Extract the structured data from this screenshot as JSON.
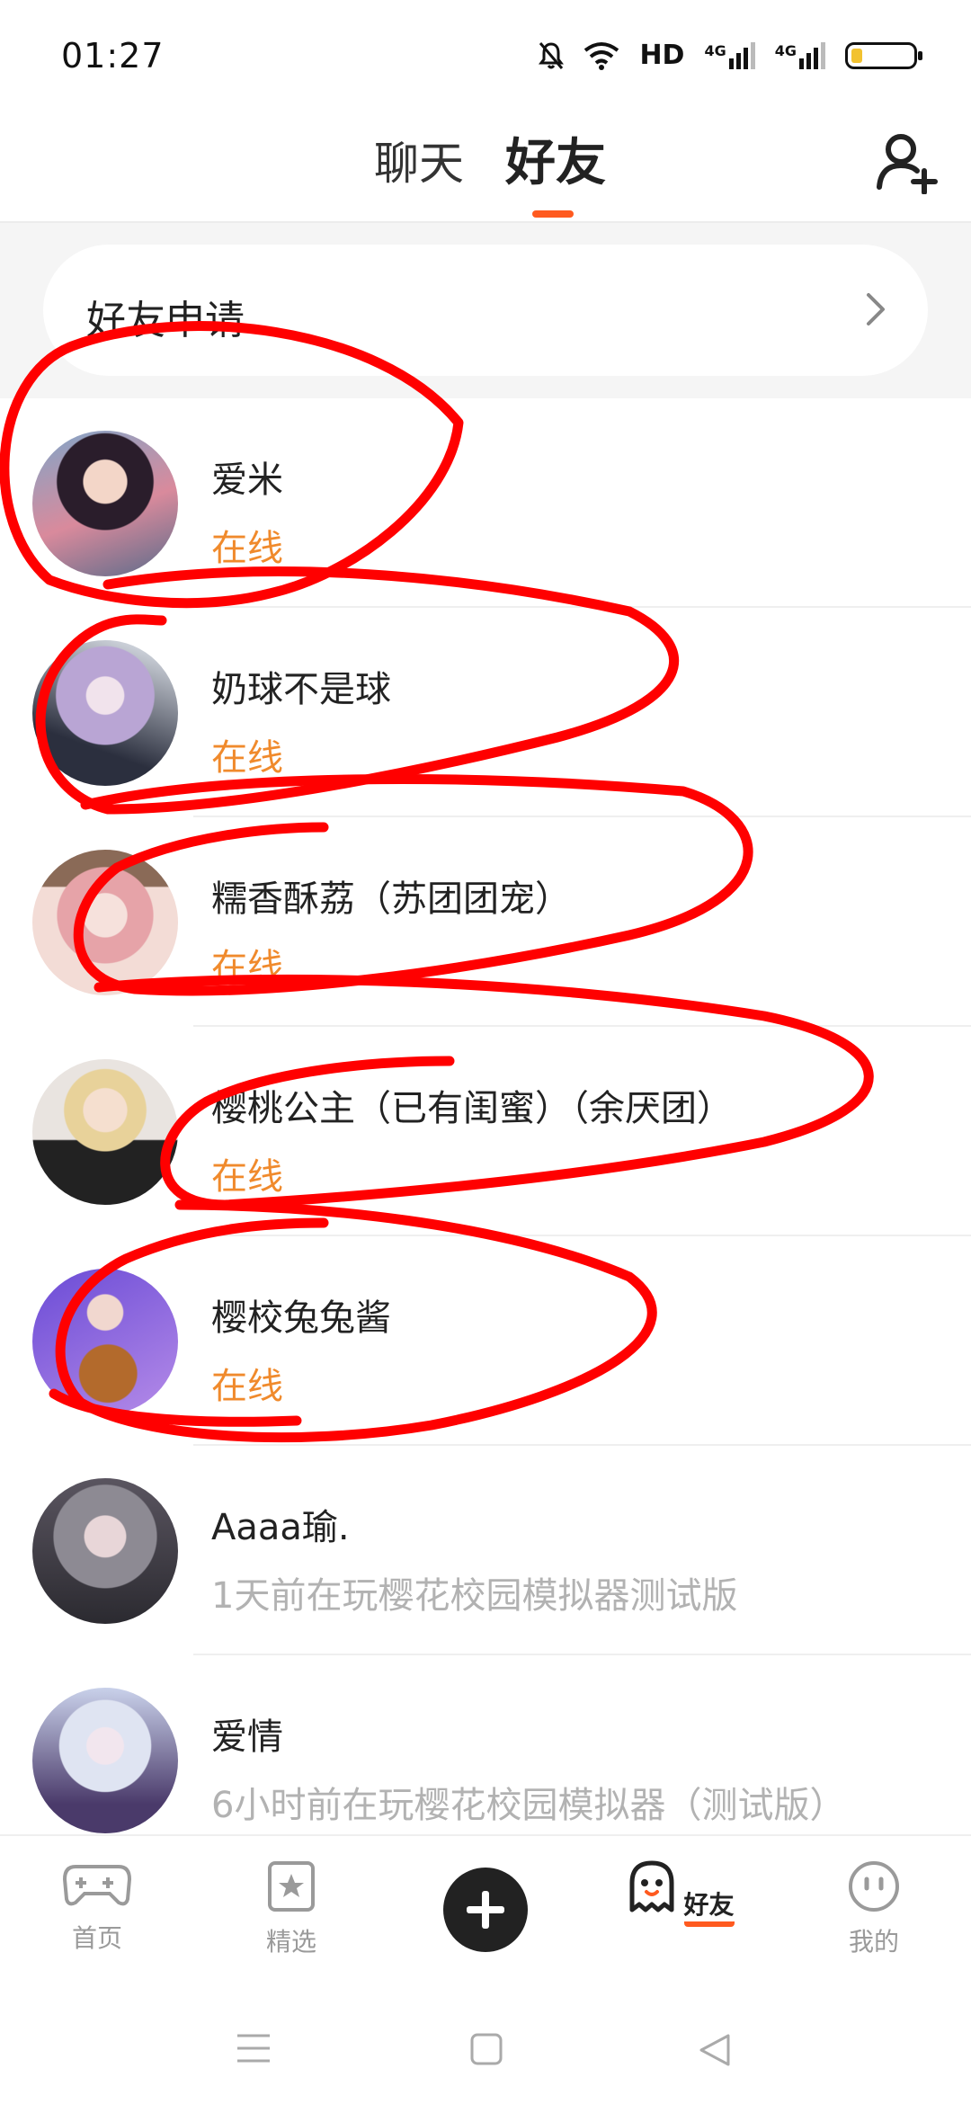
{
  "status_bar": {
    "time": "01:27",
    "hd_label": "HD",
    "network_1": "4G",
    "network_2": "4G",
    "icons": [
      "mute-icon",
      "wifi-icon",
      "hd-icon",
      "signal-4g-icon",
      "signal-4g-icon",
      "battery-icon"
    ],
    "battery_level": 0.15
  },
  "header": {
    "tab_chat": "聊天",
    "tab_friends": "好友",
    "active_tab": "好友",
    "accent_color": "#ff5a1f"
  },
  "friend_request": {
    "label": "好友申请"
  },
  "friends": [
    {
      "name": "爱米",
      "status": "在线",
      "online": true
    },
    {
      "name": "奶球不是球",
      "status": "在线",
      "online": true
    },
    {
      "name": "糯香酥荔（苏团团宠）",
      "status": "在线",
      "online": true
    },
    {
      "name": "樱桃公主（已有闺蜜）（余厌团）",
      "status": "在线",
      "online": true
    },
    {
      "name": "樱校兔兔酱",
      "status": "在线",
      "online": true
    },
    {
      "name": "Aaaa瑜.",
      "status": "1天前在玩樱花校园模拟器测试版",
      "online": false
    },
    {
      "name": "爱情",
      "status": "6小时前在玩樱花校园模拟器（测试版）",
      "online": false
    }
  ],
  "bottom_nav": {
    "home": "首页",
    "featured": "精选",
    "friends": "好友",
    "mine": "我的",
    "active": "好友"
  },
  "colors": {
    "online_status": "#f08a2c",
    "offline_status": "#b2b2b2",
    "annotation": "#ff0000"
  }
}
